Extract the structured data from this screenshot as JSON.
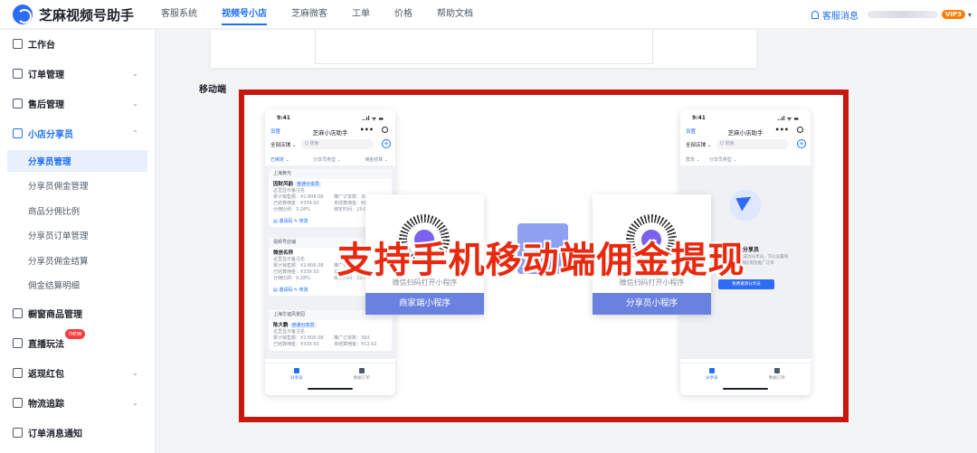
{
  "app": {
    "name": "芝麻视频号助手"
  },
  "nav": [
    {
      "label": "客服系统"
    },
    {
      "label": "视频号小店",
      "active": true
    },
    {
      "label": "芝麻微客"
    },
    {
      "label": "工单"
    },
    {
      "label": "价格"
    },
    {
      "label": "帮助文档"
    }
  ],
  "top_right": {
    "service_msg": "客服消息",
    "vip_badge": "VIP3"
  },
  "sidebar": {
    "items": [
      {
        "label": "工作台",
        "icon": "monitor-icon"
      },
      {
        "label": "订单管理",
        "icon": "clipboard-icon",
        "arrow": "⌄"
      },
      {
        "label": "售后管理",
        "icon": "refund-icon",
        "arrow": "⌄"
      },
      {
        "label": "小店分享员",
        "icon": "people-icon",
        "arrow": "⌃",
        "open": true
      },
      {
        "label": "橱窗商品管理",
        "icon": "window-icon"
      },
      {
        "label": "直播玩法",
        "icon": "play-icon",
        "badge": "new"
      },
      {
        "label": "返现红包",
        "icon": "redpacket-icon",
        "arrow": "⌄"
      },
      {
        "label": "物流追踪",
        "icon": "truck-icon",
        "arrow": "⌄"
      },
      {
        "label": "订单消息通知",
        "icon": "notice-icon"
      }
    ],
    "sub_items": [
      {
        "label": "分享员管理",
        "active": true
      },
      {
        "label": "分享员佣金管理"
      },
      {
        "label": "商品分佣比例"
      },
      {
        "label": "分享员订单管理"
      },
      {
        "label": "分享员佣金结算"
      },
      {
        "label": "佣金结算明细"
      }
    ]
  },
  "main": {
    "section_label": "移动端",
    "overlay_title": "支持手机移动端佣金提现",
    "left_phone": {
      "time": "9:41",
      "signal": "..ıl ᯤ ▬",
      "settings": "设置",
      "title": "芝麻小店助手",
      "dots": "•••",
      "filter": "全部店铺 ⌄",
      "search_placeholder": "Q 搜索",
      "add": "+",
      "tabs": [
        "已绑定 ⌄",
        "分享员类型 ⌄",
        "佣金结算 ⌄"
      ],
      "stores": [
        {
          "store": "上海黄光",
          "name": "因财风韵",
          "tag": "普通分享员",
          "sub": "这里显示备注名",
          "lines": [
            "累计销售额：¥2,806.08",
            "已结算佣金：¥339.93",
            "分佣比例：3.28%"
          ],
          "rlines": [
            "推广订单数：393",
            "未结算佣金：¥12.62",
            "绑定时间：23-02"
          ],
          "foot": "▤ 邀请码    ✎ 修改"
        },
        {
          "store": "视频号店铺",
          "name": "微信名称",
          "tag": "",
          "sub": "这里显示备注名",
          "lines": [
            "累计销售额：¥2,806.08",
            "已结算佣金：¥339.93",
            "分佣比例：9.28%"
          ],
          "rlines": [
            "推广订单数：393",
            "未结算佣金：¥12.62",
            "绑定时间：23-02"
          ],
          "foot": "▤ 邀请码    ✎ 修改"
        },
        {
          "store": "上海华谊风景园",
          "name": "陈大鹏",
          "tag": "普通分享员",
          "sub": "这里显示备注名",
          "lines": [
            "累计销售额：¥2,806.08",
            "已结算佣金：¥339.93"
          ],
          "rlines": [
            "推广订单数：393",
            "未结算佣金：¥12.62"
          ],
          "foot": ""
        }
      ],
      "bottom_nav": [
        "分享员",
        "数据订单"
      ]
    },
    "right_phone": {
      "time": "9:41",
      "signal": "..ıl ᯤ ▬",
      "settings": "设置",
      "title": "芝麻小店助手",
      "dots": "•••",
      "filter": "全部店铺 ⌄",
      "search_placeholder": "Q 搜索",
      "add": "+",
      "tabs": [
        "群发 ⌄",
        "分享员类型 ⌄"
      ],
      "empty_title": "暂无分享员",
      "empty_desc": "暂无分享员，邀请好友成为分享员，可以设置每个分享员的分佣比例及推广订单",
      "empty_button": "免费邀请分享员",
      "bottom_nav": [
        "分享员",
        "数据订单"
      ]
    },
    "qr_cards": [
      {
        "text": "微信扫码打开小程序",
        "button": "商家端小程序"
      },
      {
        "text": "微信扫码打开小程序",
        "button": "分享员小程序"
      }
    ]
  }
}
